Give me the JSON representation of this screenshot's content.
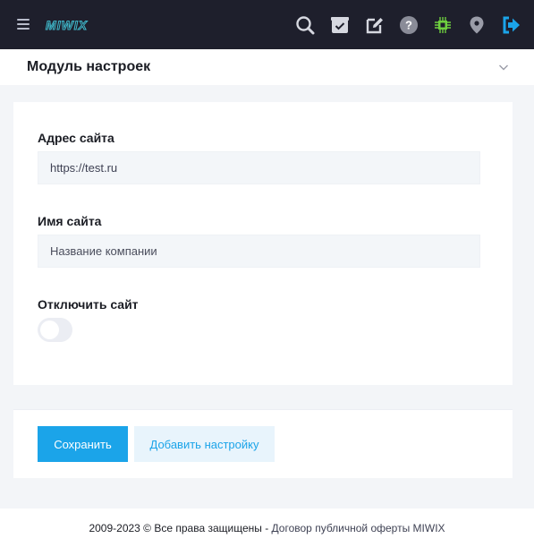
{
  "topbar": {
    "logo_text": "MIWIX",
    "icons": [
      "search-icon",
      "inbox-check-icon",
      "edit-icon",
      "help-icon",
      "chip-icon",
      "location-pin-icon",
      "logout-icon"
    ]
  },
  "header": {
    "title": "Модуль настроек"
  },
  "form": {
    "site_address": {
      "label": "Адрес сайта",
      "value": "https://test.ru"
    },
    "site_name": {
      "label": "Имя сайта",
      "placeholder": "Название компании"
    },
    "disable_site": {
      "label": "Отключить сайт",
      "checked": false
    }
  },
  "actions": {
    "save_label": "Сохранить",
    "add_setting_label": "Добавить настройку"
  },
  "footer": {
    "copyright": "2009-2023 © Все права защищены - ",
    "link_text": "Договор публичной оферты MIWIX"
  },
  "colors": {
    "topbar_bg": "#1e1f2c",
    "accent": "#1ba4e9",
    "chip_green": "#6fcf3f",
    "logout_blue": "#1ba4e9"
  }
}
